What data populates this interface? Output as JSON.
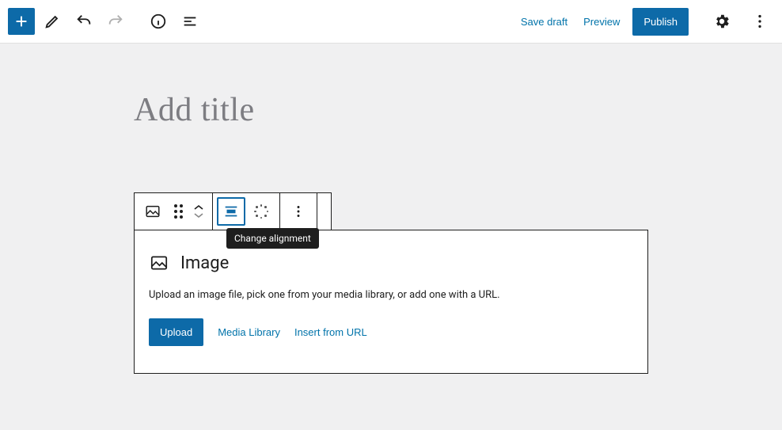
{
  "topbar": {
    "save_draft": "Save draft",
    "preview": "Preview",
    "publish": "Publish"
  },
  "title": {
    "placeholder": "Add title",
    "value": ""
  },
  "toolbar": {
    "tooltip_align": "Change alignment"
  },
  "image_block": {
    "heading": "Image",
    "description": "Upload an image file, pick one from your media library, or add one with a URL.",
    "upload": "Upload",
    "media_library": "Media Library",
    "insert_url": "Insert from URL"
  }
}
